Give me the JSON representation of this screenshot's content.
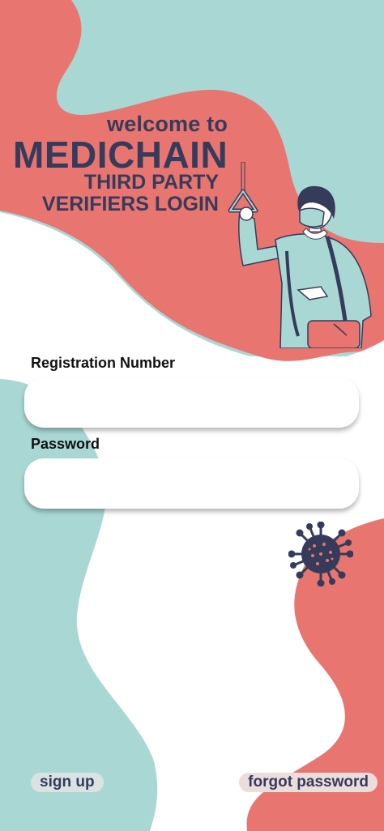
{
  "header": {
    "welcome": "welcome to",
    "app_name": "MEDICHAIN",
    "subtitle_line1": "THIRD PARTY",
    "subtitle_line2": "VERIFIERS LOGIN"
  },
  "form": {
    "registration_label": "Registration Number",
    "registration_value": "",
    "password_label": "Password",
    "password_value": ""
  },
  "footer": {
    "signup_label": "sign up",
    "forgot_label": "forgot password"
  },
  "colors": {
    "coral": "#e8756f",
    "teal": "#a9d8d4",
    "navy": "#363b5b",
    "white": "#ffffff"
  },
  "icons": [
    "virus-icon",
    "commuter-woman-illustration",
    "strap-handle-icon"
  ]
}
